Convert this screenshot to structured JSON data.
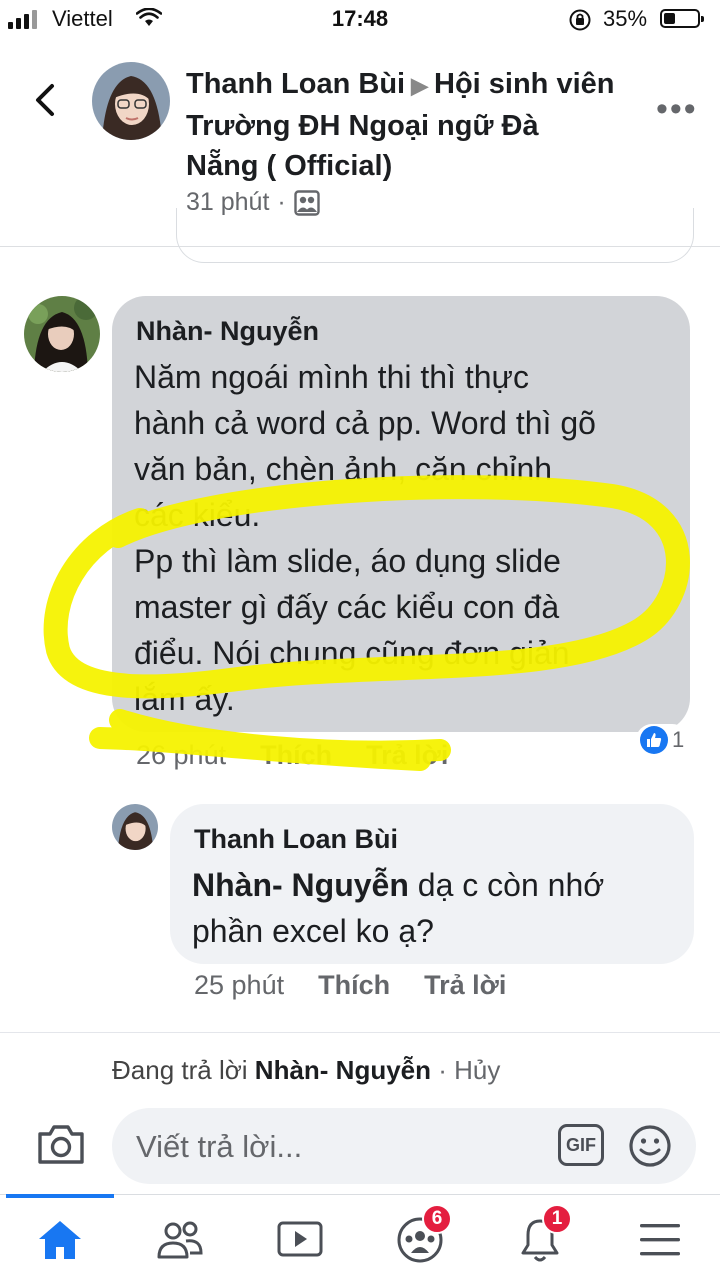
{
  "status_bar": {
    "carrier": "Viettel",
    "time": "17:48",
    "battery": "35%",
    "battery_level": 0.35
  },
  "header": {
    "author": "Thanh Loan Bùi",
    "group": "Hội sinh viên Trường ĐH Ngoại ngữ Đà Nẵng ( Official)",
    "time": "31 phút",
    "separator": "·",
    "privacy_icon": "group-icon",
    "back_icon": "chevron-left-icon",
    "more_icon": "more-horizontal-icon"
  },
  "comments": [
    {
      "author": "Nhàn- Nguyễn",
      "lines": [
        "Năm ngoái mình thi thì thực",
        "hành cả word cả pp. Word thì gõ",
        "văn bản, chèn ảnh, căn chỉnh",
        "các kiểu.",
        "Pp thì làm slide, áo dụng slide",
        "master gì đấy các kiểu con đà",
        "điểu. Nói chung cũng đơn giản",
        "lắm ấy."
      ],
      "time": "26 phút",
      "like_label": "Thích",
      "reply_label": "Trả lời",
      "reaction_count": "1",
      "highlighted": true
    },
    {
      "author": "Thanh Loan Bùi",
      "mention": "Nhàn- Nguyễn",
      "text": " dạ c còn nhớ",
      "text_line2": "phần excel ko ạ?",
      "time": "25 phút",
      "like_label": "Thích",
      "reply_label": "Trả lời"
    }
  ],
  "reply_bar": {
    "replying_prefix": "Đang trả lời",
    "replying_to": "Nhàn- Nguyễn",
    "cancel": "· Hủy",
    "placeholder": "Viết trả lời...",
    "gif_label": "GIF"
  },
  "tabbar": {
    "tabs": [
      {
        "name": "home",
        "icon": "home-icon",
        "active": true
      },
      {
        "name": "friends",
        "icon": "friends-icon"
      },
      {
        "name": "watch",
        "icon": "video-icon"
      },
      {
        "name": "groups",
        "icon": "groups-icon",
        "badge": "6"
      },
      {
        "name": "notifications",
        "icon": "bell-icon",
        "badge": "1"
      },
      {
        "name": "menu",
        "icon": "menu-icon"
      }
    ]
  },
  "colors": {
    "accent": "#1877f2",
    "badge": "#e41e3f",
    "highlighter": "#f5f200",
    "bubble": "#d2d4d8"
  }
}
